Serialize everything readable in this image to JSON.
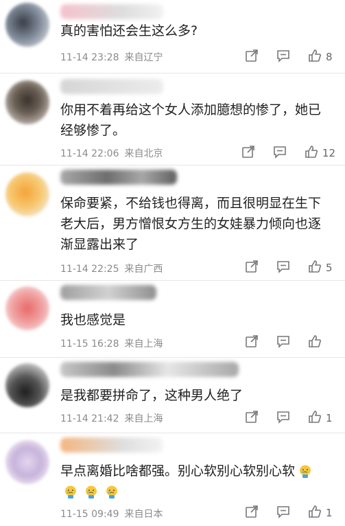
{
  "comments": [
    {
      "text": "真的害怕还会生这么多?",
      "date": "11-14 23:28",
      "location": "来自辽宁",
      "likes": "8",
      "emoji_count": 0
    },
    {
      "text": "你用不着再给这个女人添加臆想的惨了，她已\n经够惨了。",
      "date": "11-14 22:06",
      "location": "来自北京",
      "likes": "12",
      "emoji_count": 0
    },
    {
      "text": "保命要紧，不给钱也得离，而且很明显在生下\n老大后，男方憎恨女方生的女娃暴力倾向也逐\n渐显露出来了",
      "date": "11-14 22:25",
      "location": "来自广西",
      "likes": "5",
      "emoji_count": 0
    },
    {
      "text": "我也感觉是",
      "date": "11-15 16:28",
      "location": "来自上海",
      "likes": "",
      "emoji_count": 0
    },
    {
      "text": "是我都要拼命了，这种男人绝了",
      "date": "11-14 21:42",
      "location": "来自上海",
      "likes": "1",
      "emoji_count": 0
    },
    {
      "text": "早点离婚比啥都强。别心软别心软别心软",
      "date": "11-15 09:49",
      "location": "来自日本",
      "likes": "1",
      "emoji_count": 4
    }
  ],
  "icons": {
    "share": "share-icon",
    "reply": "reply-icon",
    "like": "thumbs-up-icon",
    "emoji": "crying-face-emoji-icon"
  },
  "colors": {
    "text": "#1f1f1f",
    "meta": "#8a8a8a",
    "divider": "#e6e6e6"
  }
}
